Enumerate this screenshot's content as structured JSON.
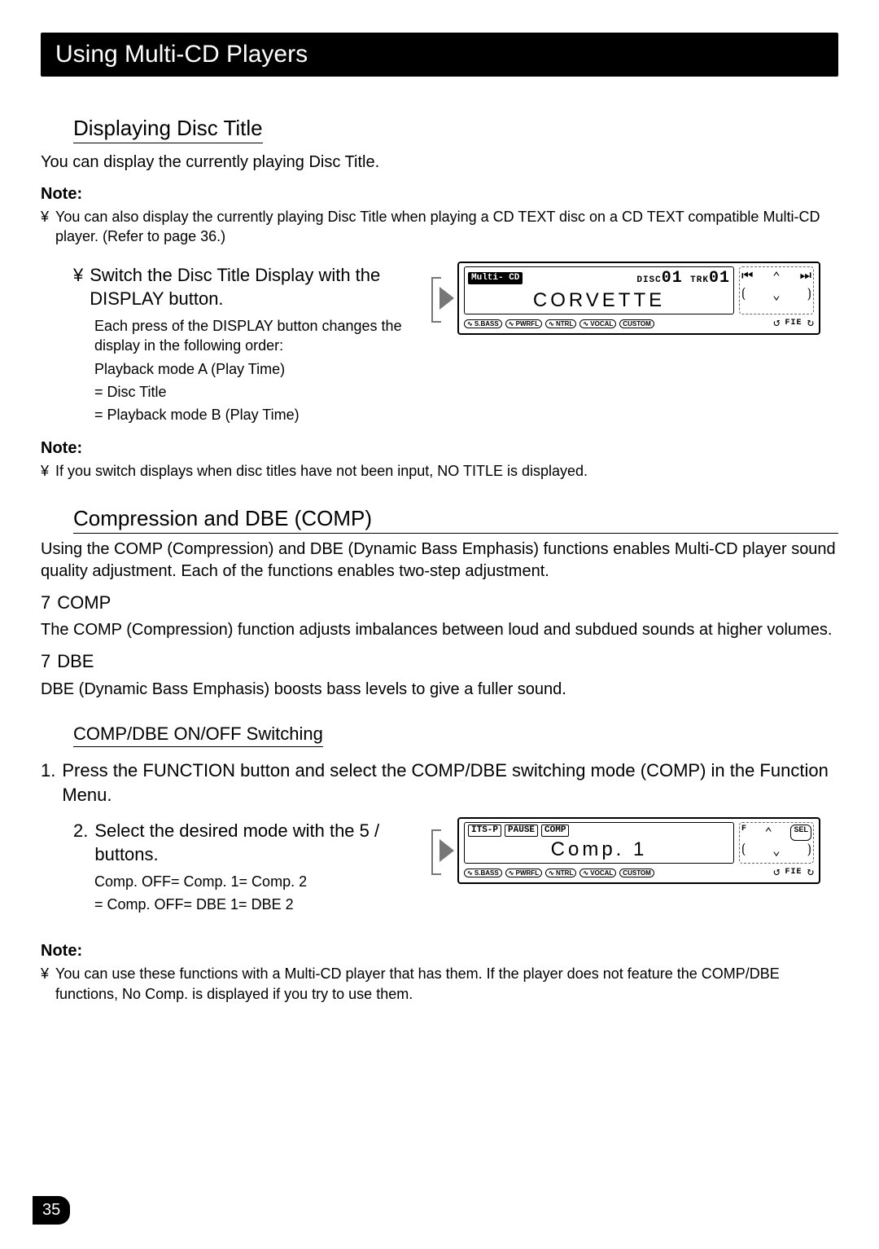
{
  "title": "Using Multi-CD Players",
  "page_number": "35",
  "sec1": {
    "heading": "Displaying Disc Title",
    "intro": "You can display the currently playing Disc Title.",
    "note_label": "Note:",
    "note_bullet_sym": "¥",
    "note_bullet": "You can also display the currently playing Disc Title when playing a CD TEXT disc on a CD TEXT compatible Multi-CD player. (Refer to page 36.)",
    "step_sym": "¥",
    "step_title": "Switch the Disc Title Display with the DISPLAY button.",
    "step_body1": "Each press of the DISPLAY button changes the display in the following order:",
    "step_body2": "Playback mode A (Play Time)",
    "step_body3": "=  Disc Title",
    "step_body4": "=  Playback mode B (Play Time)",
    "note2_label": "Note:",
    "note2_sym": "¥",
    "note2_text": "If you switch displays when disc titles have not been input,  NO TITLE  is displayed."
  },
  "lcd1": {
    "badge": "Multi-\nCD",
    "disc_label": "DISC",
    "disc_no": "01",
    "trk_label": "TRK",
    "trk_no": "01",
    "big": "CORVETTE",
    "tags": [
      "∿ S.BASS",
      "∿ PWRFL",
      "∿ NTRL",
      "∿ VOCAL",
      "CUSTOM"
    ],
    "nav_prev": "⏮",
    "nav_up": "⌃",
    "nav_next": "⏭",
    "nav_l": "⟮",
    "nav_dn": "⌄",
    "nav_r": "⟯",
    "loop": "↺",
    "fie": "FIE",
    "shuf": "↻"
  },
  "sec2": {
    "heading": "Compression and DBE (COMP)",
    "intro": "Using the COMP (Compression) and DBE (Dynamic Bass Emphasis) functions enables Multi-CD player sound quality adjustment. Each of the functions enables two-step adjustment.",
    "comp_sym": "7",
    "comp_title": "COMP",
    "comp_body": "The COMP (Compression) function adjusts imbalances between loud and subdued sounds at higher volumes.",
    "dbe_sym": "7",
    "dbe_title": "DBE",
    "dbe_body": "DBE (Dynamic Bass Emphasis) boosts bass levels to give a fuller sound."
  },
  "sec3": {
    "heading": "COMP/DBE ON/OFF Switching",
    "s1_no": "1.",
    "s1": "Press the FUNCTION button and select the COMP/DBE switching mode (COMP) in the Function Menu.",
    "s2_no": "2.",
    "s2": "Select the desired mode with the 5 /   buttons.",
    "s2_body1": "Comp. OFF=  Comp. 1=  Comp. 2",
    "s2_body2": "=  Comp. OFF=  DBE 1=  DBE 2",
    "note_label": "Note:",
    "note_sym": "¥",
    "note_text": "You can use these functions with a Multi-CD player that has them. If the player does not feature the COMP/DBE functions,  No Comp.  is displayed if you try to use them."
  },
  "lcd2": {
    "top_tags": [
      "ITS-P",
      "PAUSE",
      "COMP"
    ],
    "big": "Comp.  1",
    "tags": [
      "∿ S.BASS",
      "∿ PWRFL",
      "∿ NTRL",
      "∿ VOCAL",
      "CUSTOM"
    ],
    "sel": "SEL",
    "f": "F",
    "nav_up": "⌃",
    "nav_l": "⟮",
    "nav_dn": "⌄",
    "nav_r": "⟯",
    "loop": "↺",
    "fie": "FIE",
    "shuf": "↻"
  }
}
